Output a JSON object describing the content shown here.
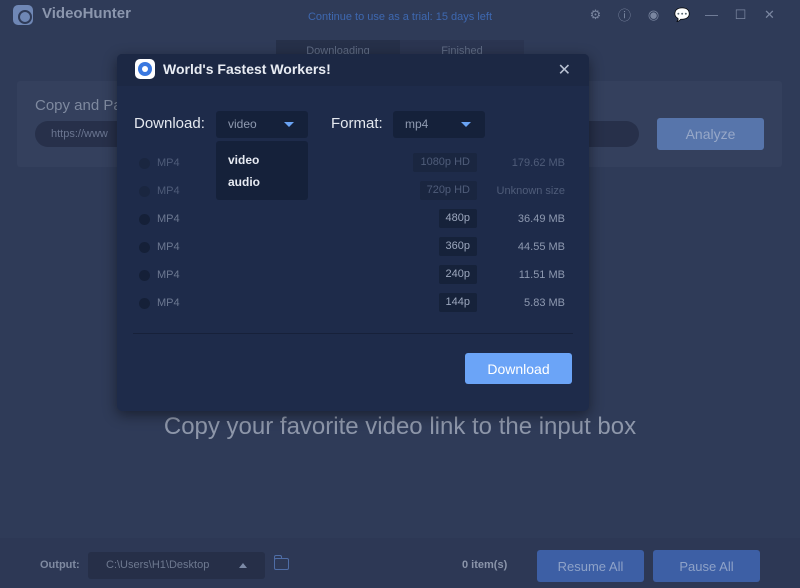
{
  "app": {
    "title": "VideoHunter",
    "trial_notice": "Continue to use as a trial: 15 days left",
    "window_icons": [
      "settings-icon",
      "info-icon",
      "account-icon",
      "feedback-icon",
      "minimize-icon",
      "maximize-icon",
      "close-icon"
    ],
    "tabs": [
      {
        "label": "Downloading",
        "active": true
      },
      {
        "label": "Finished",
        "active": false
      }
    ],
    "input_panel": {
      "label": "Copy and Paste URL here",
      "url_value": "https://www",
      "analyze_label": "Analyze"
    },
    "hint": "Copy your favorite video link to the input box",
    "footer": {
      "output_label": "Output:",
      "output_path": "C:\\Users\\H1\\Desktop",
      "items_count": "0 item(s)",
      "resume_label": "Resume All",
      "pause_label": "Pause All"
    }
  },
  "modal": {
    "title": "World's Fastest Workers!",
    "download_label": "Download:",
    "download_value": "video",
    "download_options": [
      "video",
      "audio"
    ],
    "format_label": "Format:",
    "format_value": "mp4",
    "rows": [
      {
        "format": "MP4",
        "quality": "1080p HD",
        "size": "179.62 MB",
        "enabled": false
      },
      {
        "format": "MP4",
        "quality": "720p HD",
        "size": "Unknown size",
        "enabled": false
      },
      {
        "format": "MP4",
        "quality": "480p",
        "size": "36.49 MB",
        "enabled": true
      },
      {
        "format": "MP4",
        "quality": "360p",
        "size": "44.55 MB",
        "enabled": true
      },
      {
        "format": "MP4",
        "quality": "240p",
        "size": "11.51 MB",
        "enabled": true
      },
      {
        "format": "MP4",
        "quality": "144p",
        "size": "5.83 MB",
        "enabled": true
      }
    ],
    "download_button": "Download"
  },
  "colors": {
    "accent": "#6ba4f7",
    "trial_text": "#3e68b0",
    "modal_bg": "#1e2b4a"
  }
}
